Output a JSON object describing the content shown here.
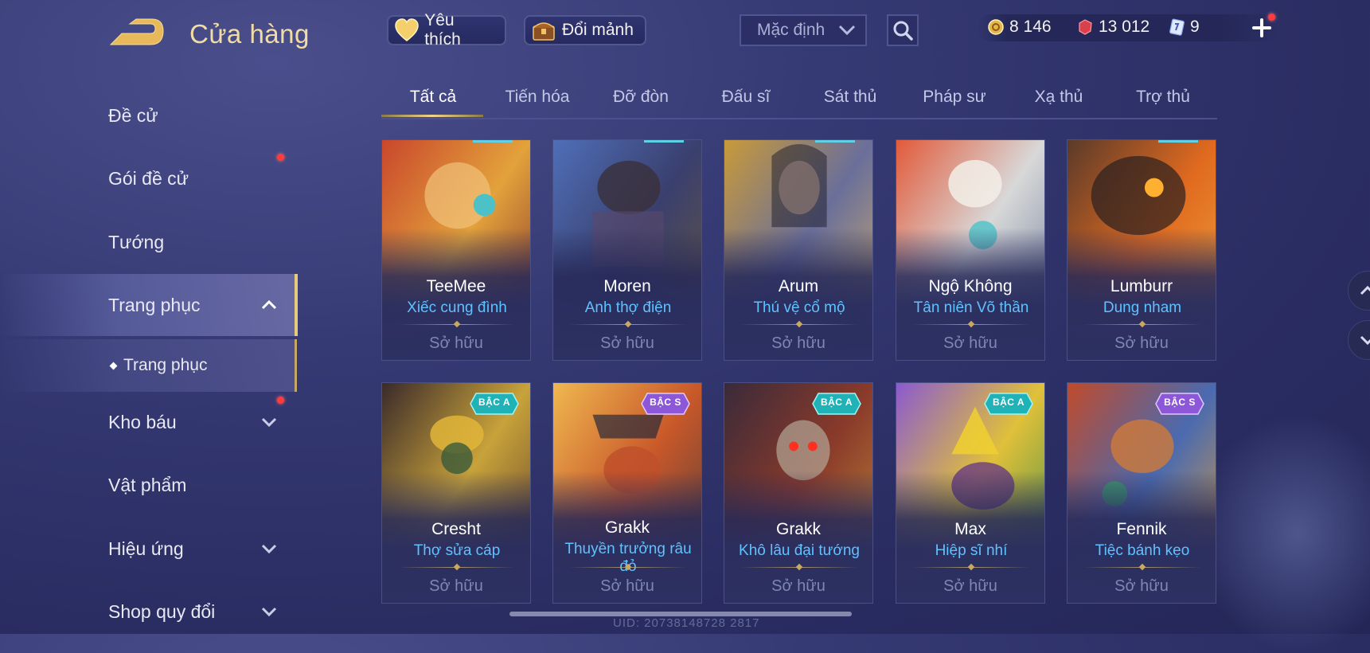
{
  "header": {
    "title": "Cửa hàng",
    "favorite_label": "Yêu thích",
    "exchange_label": "Đổi mảnh",
    "sort_value": "Mặc định"
  },
  "currency": {
    "gold": "8 146",
    "quan_huy": "13 012",
    "voucher": "9"
  },
  "sidebar": {
    "items": [
      {
        "label": "Đề cử"
      },
      {
        "label": "Gói đề cử"
      },
      {
        "label": "Tướng"
      },
      {
        "label": "Trang phục"
      },
      {
        "label": "Trang phục"
      },
      {
        "label": "Kho báu"
      },
      {
        "label": "Vật phẩm"
      },
      {
        "label": "Hiệu ứng"
      },
      {
        "label": "Shop quy đổi"
      }
    ]
  },
  "tabs": [
    {
      "label": "Tất cả"
    },
    {
      "label": "Tiến hóa"
    },
    {
      "label": "Đỡ đòn"
    },
    {
      "label": "Đấu sĩ"
    },
    {
      "label": "Sát thủ"
    },
    {
      "label": "Pháp sư"
    },
    {
      "label": "Xạ thủ"
    },
    {
      "label": "Trợ thủ"
    }
  ],
  "cards": [
    {
      "hero": "TeeMee",
      "skin": "Xiếc cung đình",
      "status": "Sở hữu"
    },
    {
      "hero": "Moren",
      "skin": "Anh thợ điện",
      "status": "Sở hữu"
    },
    {
      "hero": "Arum",
      "skin": "Thú vệ cổ mộ",
      "status": "Sở hữu"
    },
    {
      "hero": "Ngộ Không",
      "skin": "Tân niên Võ thần",
      "status": "Sở hữu"
    },
    {
      "hero": "Lumburr",
      "skin": "Dung nham",
      "status": "Sở hữu"
    },
    {
      "hero": "Cresht",
      "skin": "Thợ sửa cáp",
      "status": "Sở hữu",
      "badge": "BẬC A"
    },
    {
      "hero": "Grakk",
      "skin": "Thuyền trưởng râu đỏ",
      "status": "Sở hữu",
      "badge": "BẬC S"
    },
    {
      "hero": "Grakk",
      "skin": "Khô lâu đại tướng",
      "status": "Sở hữu",
      "badge": "BẬC A"
    },
    {
      "hero": "Max",
      "skin": "Hiệp sĩ nhí",
      "status": "Sở hữu",
      "badge": "BẬC A"
    },
    {
      "hero": "Fennik",
      "skin": "Tiệc bánh kẹo",
      "status": "Sở hữu",
      "badge": "BẬC S"
    }
  ],
  "footer": {
    "uid": "UID: 20738148728 2817"
  },
  "colors": {
    "accent_gold": "#f1dca3",
    "skin_name_blue": "#5fc2ff",
    "badge_a": "#1fb3b8",
    "badge_s": "#8c58d9",
    "notification_red": "#ff3b3b"
  }
}
